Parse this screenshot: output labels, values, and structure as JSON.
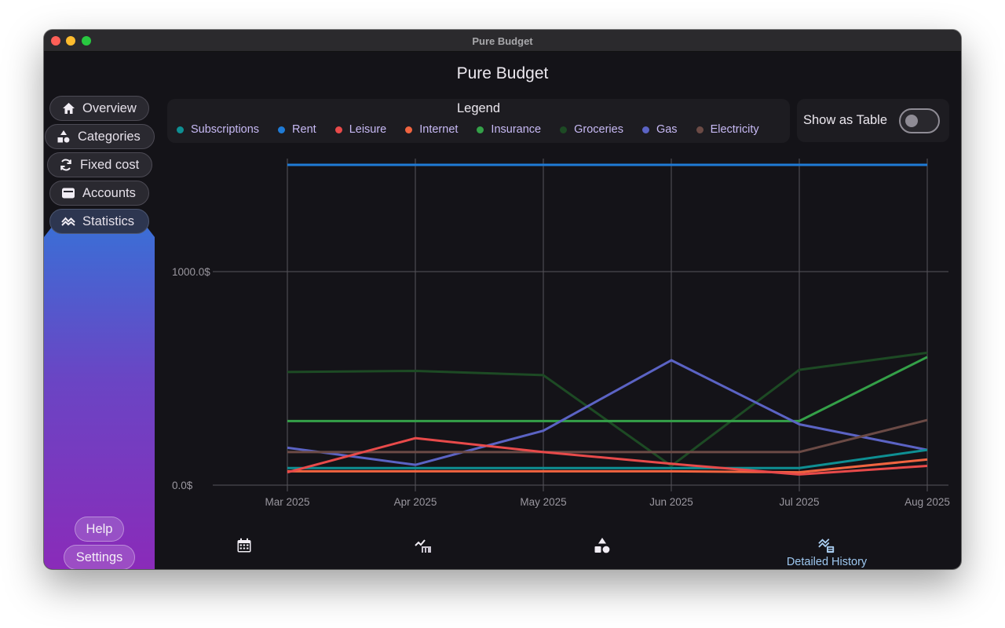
{
  "window": {
    "title": "Pure Budget"
  },
  "app": {
    "title": "Pure Budget"
  },
  "sidebar": {
    "items": [
      {
        "label": "Overview",
        "icon": "home-icon"
      },
      {
        "label": "Categories",
        "icon": "shapes-icon"
      },
      {
        "label": "Fixed cost",
        "icon": "refresh-icon"
      },
      {
        "label": "Accounts",
        "icon": "wallet-icon"
      },
      {
        "label": "Statistics",
        "icon": "stats-icon",
        "active": true
      }
    ],
    "help_label": "Help",
    "settings_label": "Settings"
  },
  "legend": {
    "title": "Legend",
    "items": [
      {
        "label": "Subscriptions",
        "color": "#0e8f93"
      },
      {
        "label": "Rent",
        "color": "#1f7bd6"
      },
      {
        "label": "Leisure",
        "color": "#e84a4a"
      },
      {
        "label": "Internet",
        "color": "#f06440"
      },
      {
        "label": "Insurance",
        "color": "#34a048"
      },
      {
        "label": "Groceries",
        "color": "#1d4a24"
      },
      {
        "label": "Gas",
        "color": "#5b63c4"
      },
      {
        "label": "Electricity",
        "color": "#6b4a45"
      }
    ]
  },
  "toggle": {
    "label": "Show as Table",
    "checked": false
  },
  "chart_data": {
    "type": "line",
    "x": [
      "Mar 2025",
      "Apr 2025",
      "May 2025",
      "Jun 2025",
      "Jul 2025",
      "Aug 2025"
    ],
    "y_ticks": [
      "0.0$",
      "1000.0$"
    ],
    "ylim": [
      0,
      1500
    ],
    "grid": true,
    "series": [
      {
        "name": "Rent",
        "color": "#1f7bd6",
        "values": [
          1500,
          1500,
          1500,
          1500,
          1500,
          1500
        ]
      },
      {
        "name": "Groceries",
        "color": "#1d4a24",
        "values": [
          530,
          535,
          515,
          90,
          540,
          620
        ]
      },
      {
        "name": "Insurance",
        "color": "#34a048",
        "values": [
          300,
          300,
          300,
          300,
          300,
          600
        ]
      },
      {
        "name": "Gas",
        "color": "#5b63c4",
        "values": [
          175,
          95,
          255,
          585,
          285,
          165
        ]
      },
      {
        "name": "Electricity",
        "color": "#6b4a45",
        "values": [
          155,
          155,
          155,
          155,
          155,
          305
        ]
      },
      {
        "name": "Subscriptions",
        "color": "#0e8f93",
        "values": [
          80,
          80,
          80,
          80,
          80,
          165
        ]
      },
      {
        "name": "Internet",
        "color": "#f06440",
        "values": [
          65,
          65,
          65,
          65,
          60,
          120
        ]
      },
      {
        "name": "Leisure",
        "color": "#e84a4a",
        "values": [
          60,
          220,
          155,
          100,
          50,
          90
        ]
      }
    ]
  },
  "bottom_nav": [
    {
      "icon": "calendar-icon",
      "label": ""
    },
    {
      "icon": "chart-bar-icon",
      "label": ""
    },
    {
      "icon": "shapes-icon",
      "label": ""
    },
    {
      "icon": "history-chart-icon",
      "label": "Detailed History",
      "active": true
    }
  ]
}
